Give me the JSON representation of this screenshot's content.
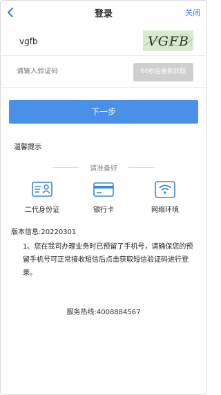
{
  "header": {
    "title": "登录",
    "close_label": "关闭"
  },
  "login": {
    "username": "vgfb",
    "captcha_text": "VGFB",
    "sms_placeholder": "请输入验证码",
    "sms_button_label": "60秒后重新获取",
    "next_label": "下一步"
  },
  "tips": {
    "title": "温馨提示",
    "prepare_label": "请准备好",
    "items": [
      {
        "label": "二代身份证",
        "icon": "id-card-icon"
      },
      {
        "label": "银行卡",
        "icon": "bank-card-icon"
      },
      {
        "label": "网络环境",
        "icon": "wifi-icon"
      }
    ],
    "version": "版本信息:20220301",
    "notice": "1、您在我司办理业务时已预留了手机号，请确保您的预留手机号可正常接收短信后点击获取短信验证码进行登录。",
    "hotline": "服务热线:4008884567"
  },
  "colors": {
    "accent": "#2f7de1",
    "button": "#4a8fe8",
    "disabled_button": "#cfcfcf",
    "captcha_background": "#d8ead0"
  }
}
